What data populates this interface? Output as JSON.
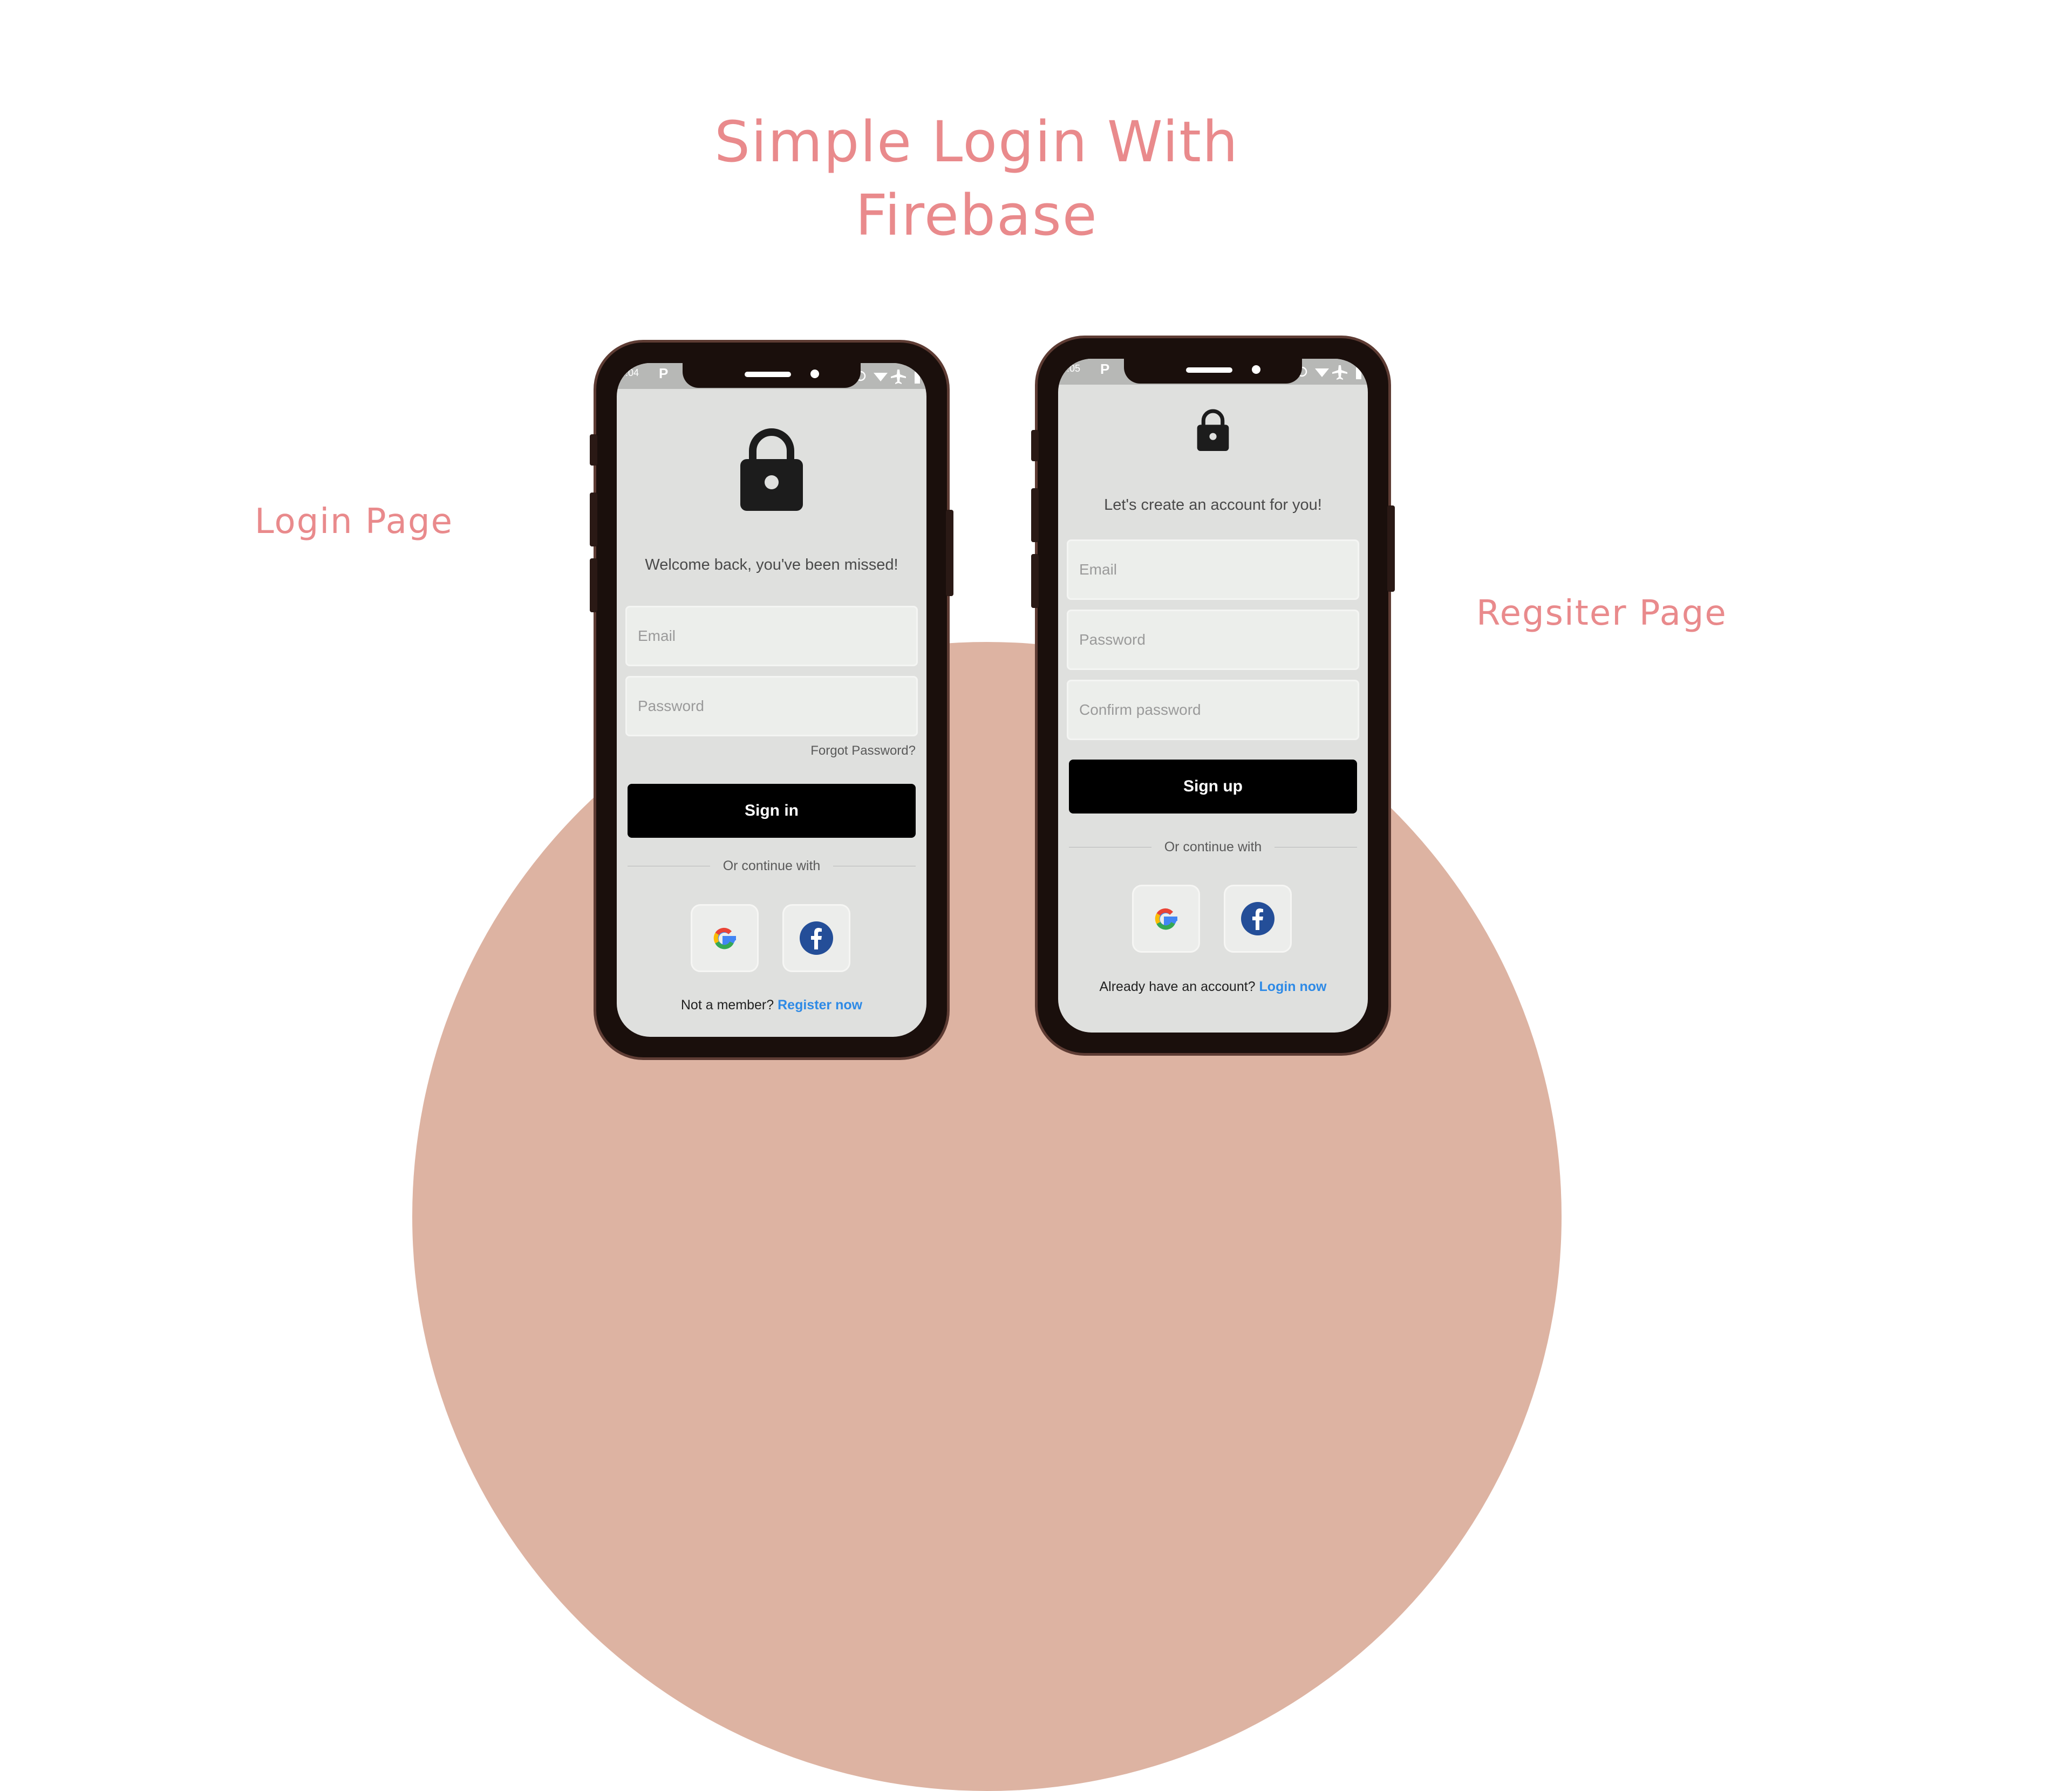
{
  "heading": {
    "line1": "Simple Login With",
    "line2": "Firebase"
  },
  "labels": {
    "login": "Login Page",
    "register": "Regsiter Page"
  },
  "colors": {
    "accent": "#e98a8c",
    "arch": "#ddb3a2",
    "phone_frame": "#1a0f0c",
    "screen_bg": "#dfe0de",
    "link": "#2e8ae6"
  },
  "login_screen": {
    "status_time": "5:04",
    "status_app_icon": "P",
    "icon": "lock-icon",
    "greeting": "Welcome back, you've been missed!",
    "email_placeholder": "Email",
    "password_placeholder": "Password",
    "forgot_password": "Forgot Password?",
    "sign_in_label": "Sign in",
    "divider_text": "Or continue with",
    "social": [
      "google-icon",
      "facebook-icon"
    ],
    "footer_text": "Not a member?",
    "footer_link": "Register now"
  },
  "register_screen": {
    "status_time": "5:05",
    "status_app_icon": "P",
    "icon": "lock-icon",
    "greeting": "Let's create an account for you!",
    "email_placeholder": "Email",
    "password_placeholder": "Password",
    "confirm_placeholder": "Confirm password",
    "sign_up_label": "Sign up",
    "divider_text": "Or continue with",
    "social": [
      "google-icon",
      "facebook-icon"
    ],
    "footer_text": "Already have an account?",
    "footer_link": "Login now"
  }
}
